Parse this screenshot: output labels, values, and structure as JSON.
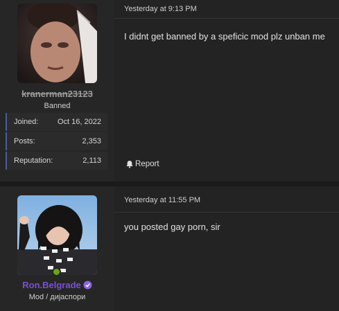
{
  "posts": [
    {
      "username": "kranerman23123",
      "user_title": "Banned",
      "stats": [
        {
          "label": "Joined:",
          "value": "Oct 16, 2022"
        },
        {
          "label": "Posts:",
          "value": "2,353"
        },
        {
          "label": "Reputation:",
          "value": "2,113"
        }
      ],
      "timestamp": "Yesterday at 9:13 PM",
      "message": "I didnt get banned by a speficic mod plz unban me",
      "report_label": "Report"
    },
    {
      "username": "Ron.Belgrade",
      "user_title": "Mod / дијаспори",
      "timestamp": "Yesterday at 11:55 PM",
      "message": "you posted gay porn, sir",
      "online": true
    }
  ],
  "colors": {
    "background": "#1f1f1f",
    "mod_username": "#7b4fd6",
    "online": "#6aa512",
    "stat_accent": "#4a5c9a"
  }
}
